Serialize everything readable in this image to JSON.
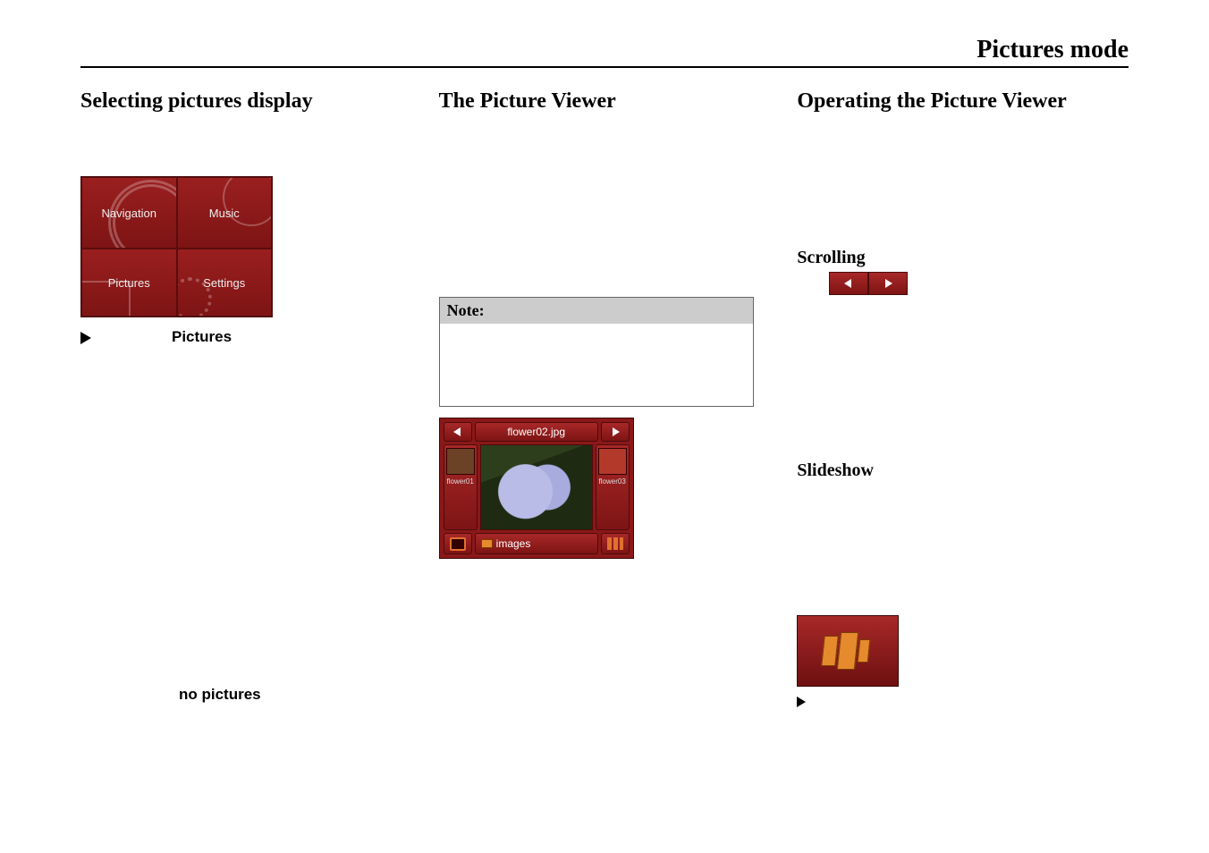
{
  "header": {
    "title": "Pictures mode"
  },
  "col1": {
    "heading": "Selecting pictures display",
    "tiles": {
      "navigation": "Navigation",
      "music": "Music",
      "pictures": "Pictures",
      "settings": "Settings"
    },
    "step_label": "Pictures",
    "no_pictures": "no  pictures"
  },
  "col2": {
    "heading": "The Picture Viewer",
    "note_label": "Note:",
    "viewer": {
      "filename": "flower02.jpg",
      "thumb_left": "flower01",
      "thumb_right": "flower03",
      "folder": "images"
    }
  },
  "col3": {
    "heading": "Operating the Picture Viewer",
    "scrolling_label": "Scrolling",
    "slideshow_label": "Slideshow"
  }
}
